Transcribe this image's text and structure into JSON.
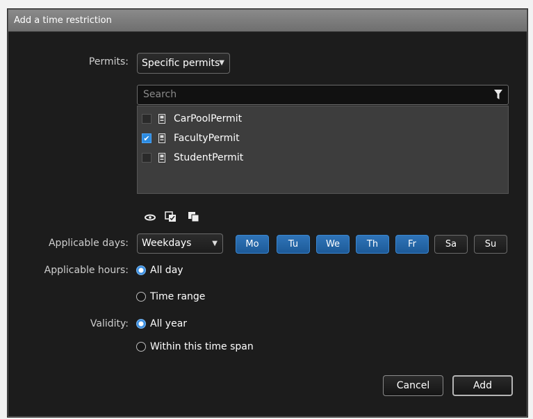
{
  "dialog": {
    "title": "Add a time restriction"
  },
  "permits": {
    "label": "Permits:",
    "selected": "Specific permits",
    "search_placeholder": "Search",
    "items": [
      {
        "label": "CarPoolPermit",
        "checked": false
      },
      {
        "label": "FacultyPermit",
        "checked": true
      },
      {
        "label": "StudentPermit",
        "checked": false
      }
    ]
  },
  "days": {
    "label": "Applicable days:",
    "selected": "Weekdays",
    "buttons": [
      {
        "label": "Mo",
        "active": true
      },
      {
        "label": "Tu",
        "active": true
      },
      {
        "label": "We",
        "active": true
      },
      {
        "label": "Th",
        "active": true
      },
      {
        "label": "Fr",
        "active": true
      },
      {
        "label": "Sa",
        "active": false
      },
      {
        "label": "Su",
        "active": false
      }
    ]
  },
  "hours": {
    "label": "Applicable hours:",
    "options": [
      {
        "label": "All day",
        "selected": true
      },
      {
        "label": "Time range",
        "selected": false
      }
    ]
  },
  "validity": {
    "label": "Validity:",
    "options": [
      {
        "label": "All year",
        "selected": true
      },
      {
        "label": "Within this time span",
        "selected": false
      }
    ]
  },
  "actions": {
    "cancel": "Cancel",
    "add": "Add"
  },
  "colors": {
    "accent": "#2c8be0",
    "background": "#1c1c1c"
  },
  "icons": [
    "filter-icon",
    "permit-icon",
    "show-icon",
    "select-all-icon",
    "deselect-all-icon"
  ]
}
